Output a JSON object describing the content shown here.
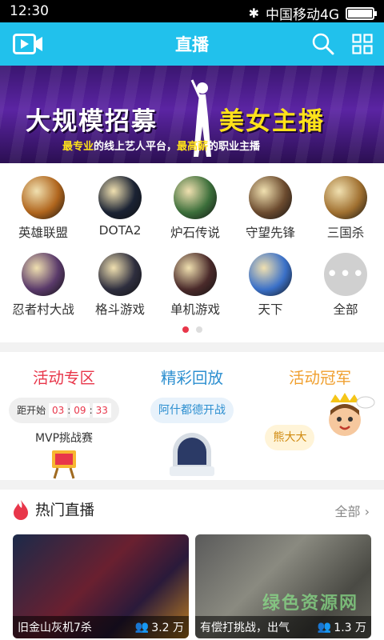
{
  "status": {
    "time": "12:30",
    "carrier": "中国移动4G",
    "battery_level": 0.95
  },
  "appbar": {
    "title": "直播",
    "left_icon": "video-camera-icon",
    "search_icon": "search-icon",
    "grid_icon": "grid-icon"
  },
  "banner": {
    "headline_left": "大规模招募",
    "headline_right": "美女主播",
    "sub_a": "最专业",
    "sub_b": "的线上艺人平台，",
    "sub_c": "最高薪",
    "sub_d": "的职业主播"
  },
  "games": [
    {
      "label": "英雄联盟",
      "color": "#b0651d"
    },
    {
      "label": "DOTA2",
      "color": "#1a2233"
    },
    {
      "label": "炉石传说",
      "color": "#3b6e3a"
    },
    {
      "label": "守望先锋",
      "color": "#6b4a2e"
    },
    {
      "label": "三国杀",
      "color": "#a07030"
    },
    {
      "label": "忍者村大战",
      "color": "#5a3a6a"
    },
    {
      "label": "格斗游戏",
      "color": "#2e2e3e"
    },
    {
      "label": "单机游戏",
      "color": "#4a2a2a"
    },
    {
      "label": "天下",
      "color": "#3a70c8"
    },
    {
      "label": "全部",
      "color": "#d0d0d0"
    }
  ],
  "activities": {
    "zone": {
      "title": "活动专区",
      "timer_prefix": "距开始",
      "h": "03",
      "m": "09",
      "s": "33",
      "caption": "MVP挑战赛",
      "color": "#e8364a"
    },
    "replay": {
      "title": "精彩回放",
      "tag": "阿什都德开战",
      "color": "#2c8fd0"
    },
    "champion": {
      "title": "活动冠军",
      "tag": "熊大大",
      "color": "#f0a030"
    }
  },
  "hot": {
    "title": "热门直播",
    "all": "全部",
    "items": [
      {
        "caption": "旧金山灰机7杀",
        "viewers": "3.2 万"
      },
      {
        "caption": "有偿打挑战，出气",
        "viewers": "1.3 万"
      }
    ]
  },
  "watermark": "绿色资源网"
}
